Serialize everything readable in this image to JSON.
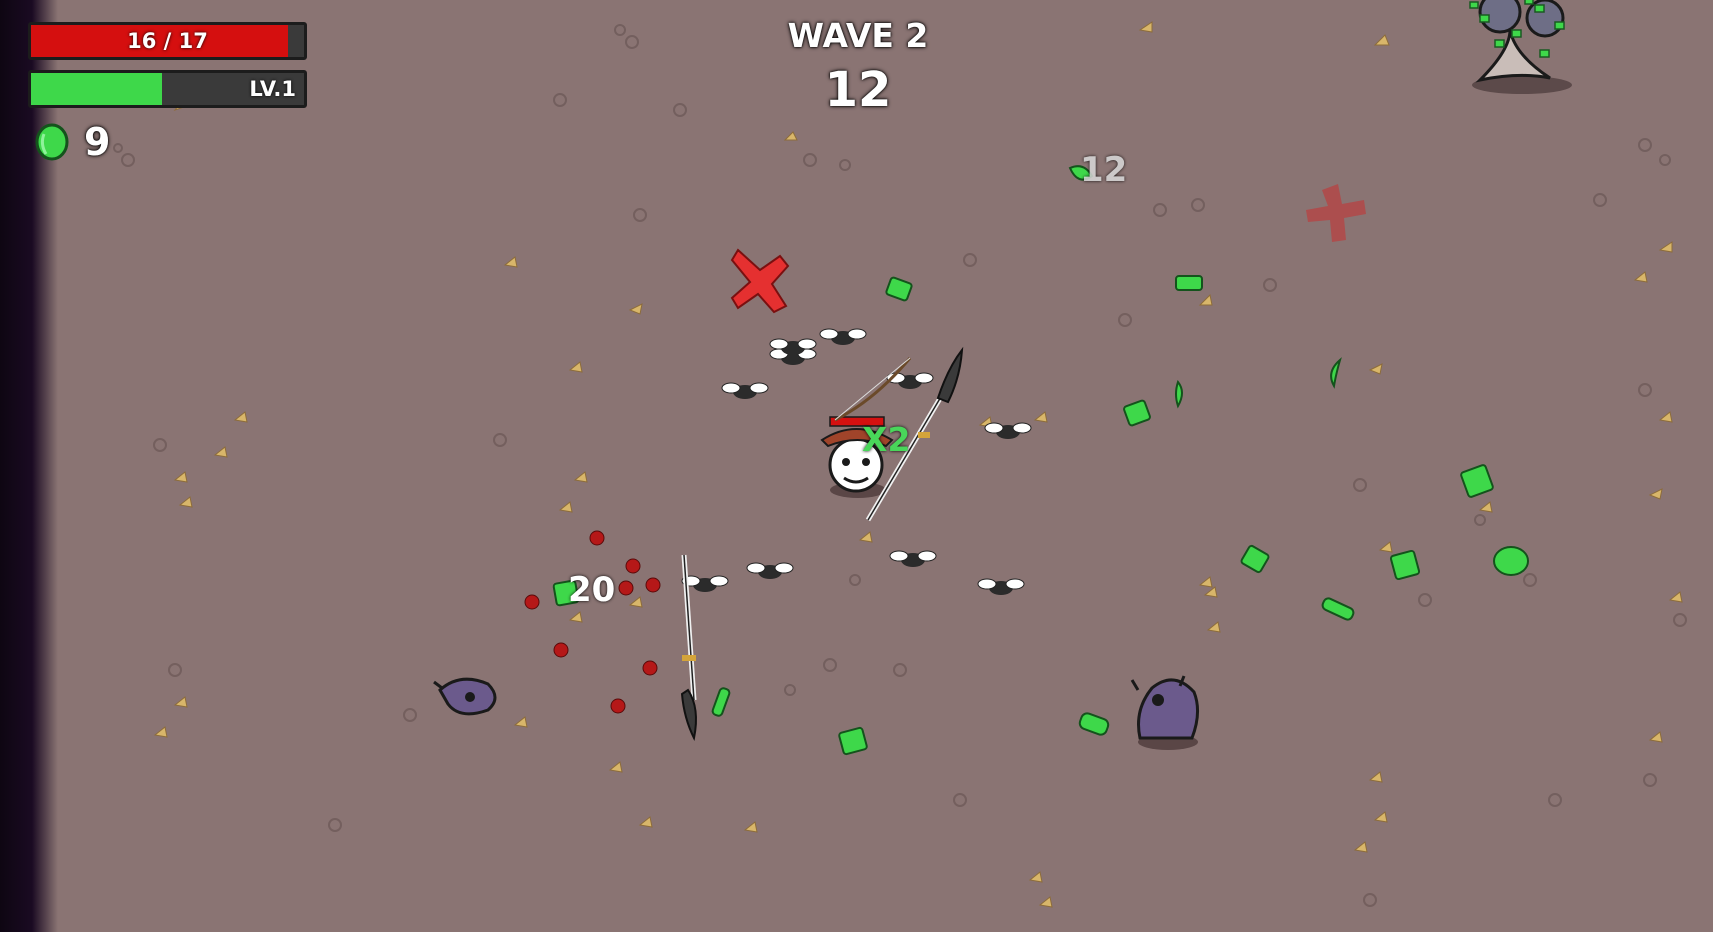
{
  "hud": {
    "hp_text": "16 / 17",
    "hp_current": 16,
    "hp_max": 17,
    "level_text": "LV.1",
    "xp_fraction": 0.48,
    "materials_count": "9",
    "wave_label": "WAVE 2",
    "wave_timer": "12"
  },
  "floating_text": {
    "damage_a": "20",
    "damage_b": "12",
    "multiplier": "X2"
  },
  "colors": {
    "ground": "#8a7473",
    "hp": "#d50f0f",
    "xp": "#3ed84a",
    "material": "#3ed84a",
    "enemy": "#6b5a8c"
  }
}
